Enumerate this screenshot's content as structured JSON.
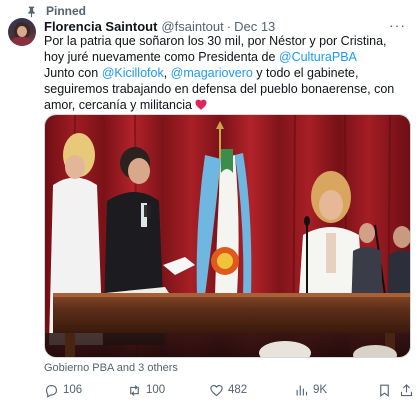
{
  "pinned_label": "Pinned",
  "author": {
    "name": "Florencia Saintout",
    "handle": "@fsaintout",
    "separator": "·",
    "date": "Dec 13"
  },
  "tweet": {
    "line1_a": "Por la patria que soñaron los 30 mil, por Néstor y por Cristina, hoy juré nuevamente como Presidenta de ",
    "mention1": "@CulturaPBA",
    "line2_a": "Junto con ",
    "mention2": "@Kicillofok",
    "line2_b": ", ",
    "mention3": "@magariovero",
    "line2_c": " y todo el gabinete, seguiremos trabajando en defensa del pueblo bonaerense, con amor, cercanía y militancia ",
    "emoji": "red-heart"
  },
  "photo": {
    "alt": "Photo of the swearing-in ceremony"
  },
  "tagged": "Gobierno PBA and 3 others",
  "actions": {
    "replies": "106",
    "retweets": "100",
    "likes": "482",
    "views": "9K"
  },
  "colors": {
    "accent": "#1d9bf0",
    "text": "#0f1419",
    "muted": "#536471",
    "heart": "#f91880"
  },
  "icons": [
    "pin-icon",
    "more-icon",
    "reply-icon",
    "retweet-icon",
    "like-icon",
    "views-icon",
    "bookmark-icon",
    "share-icon"
  ]
}
